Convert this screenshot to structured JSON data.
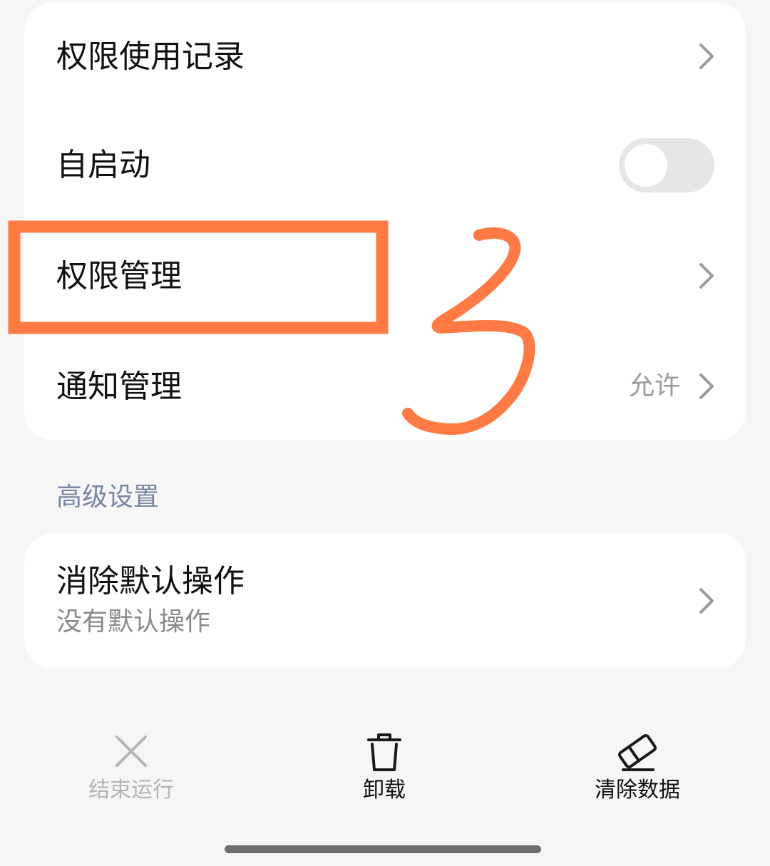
{
  "top_card": {
    "permission_usage_record": {
      "label": "权限使用记录"
    },
    "autostart": {
      "label": "自启动",
      "enabled": false
    },
    "permission_management": {
      "label": "权限管理"
    },
    "notification_management": {
      "label": "通知管理",
      "value": "允许"
    }
  },
  "advanced": {
    "section_title": "高级设置",
    "clear_defaults": {
      "title": "消除默认操作",
      "subtitle": "没有默认操作"
    }
  },
  "bottom_actions": {
    "force_stop": {
      "label": "结束运行",
      "icon": "close-icon",
      "enabled": false
    },
    "uninstall": {
      "label": "卸载",
      "icon": "trash-icon",
      "enabled": true
    },
    "clear_data": {
      "label": "清除数据",
      "icon": "eraser-icon",
      "enabled": true
    }
  },
  "annotation": {
    "color": "#ff7a45"
  }
}
